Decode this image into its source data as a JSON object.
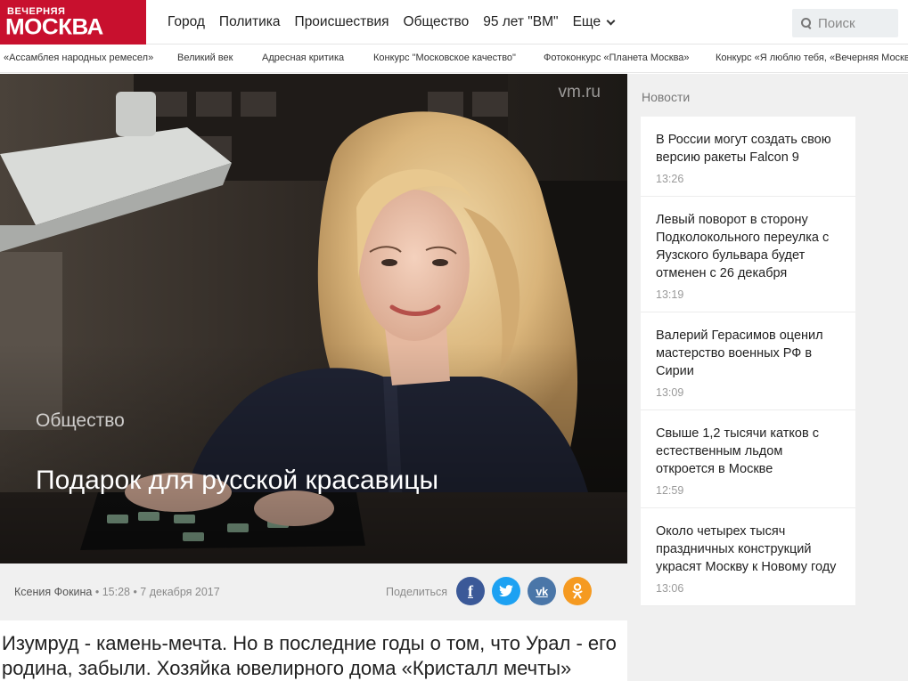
{
  "logo": {
    "top": "ВЕЧЕРНЯЯ",
    "main": "МОСКВА"
  },
  "nav": {
    "items": [
      "Город",
      "Политика",
      "Происшествия",
      "Общество",
      "95 лет \"ВМ\""
    ],
    "more_label": "Еще"
  },
  "search": {
    "placeholder": "Поиск"
  },
  "subnav": {
    "items": [
      "«Ассамблея народных ремесел»",
      "Великий век",
      "Адресная критика",
      "Конкурс \"Московское качество\"",
      "Фотоконкурс «Планета Москва»",
      "Конкурс «Я люблю тебя, «Вечерняя Москва»"
    ]
  },
  "hero": {
    "watermark": "vm.ru",
    "category": "Общество",
    "title": "Подарок для русской красавицы"
  },
  "meta": {
    "author": "Ксения Фокина",
    "time": "• 15:28 • 7 декабря 2017",
    "share_label": "Поделиться",
    "share_buttons": [
      {
        "name": "facebook",
        "glyph": "f",
        "color": "#3b5998"
      },
      {
        "name": "twitter",
        "glyph": "t",
        "color": "#1da1f2"
      },
      {
        "name": "vk",
        "glyph": "vk",
        "color": "#4a76a8"
      },
      {
        "name": "odnoklassniki",
        "glyph": "ok",
        "color": "#f59a21"
      }
    ]
  },
  "lead": {
    "text": "Изумруд - камень-мечта. Но в последние годы о том, что Урал - его родина, забыли. Хозяйка ювелирного дома «Кристалл мечты» Юлия Л..."
  },
  "sidebar": {
    "heading": "Новости",
    "items": [
      {
        "title": "В России могут создать свою версию ракеты Falcon 9",
        "time": "13:26"
      },
      {
        "title": "Левый поворот в сторону Подколокольного переулка с Яузского бульвара будет отменен с 26 декабря",
        "time": "13:19"
      },
      {
        "title": "Валерий Герасимов оценил мастерство военных РФ в Сирии",
        "time": "13:09"
      },
      {
        "title": "Свыше 1,2 тысячи катков с естественным льдом откроется в Москве",
        "time": "12:59"
      },
      {
        "title": "Около четырех тысяч праздничных конструкций украсят Москву к Новому году",
        "time": "13:06"
      }
    ]
  },
  "colors": {
    "brand": "#c8102e",
    "page_bg": "#f0f0f0"
  }
}
